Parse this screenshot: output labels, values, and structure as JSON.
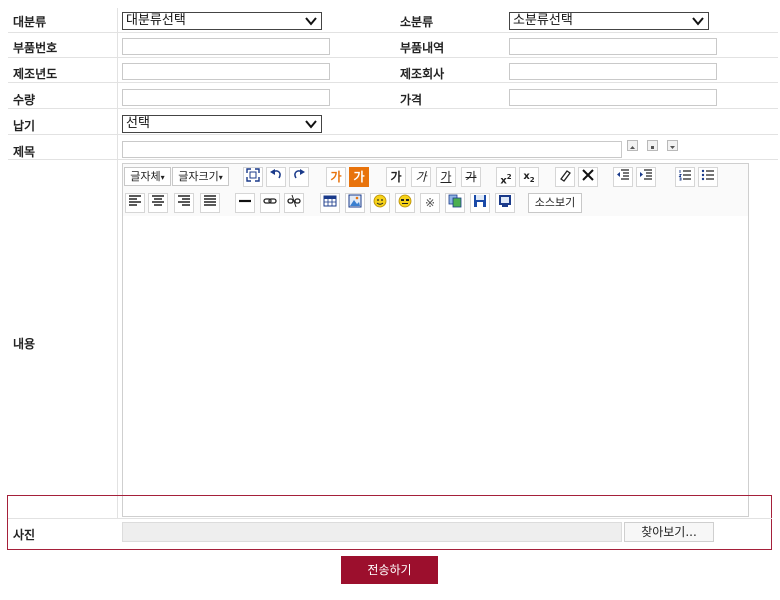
{
  "form": {
    "row_category": {
      "label": "대분류",
      "select_value": "대분류선택"
    },
    "row_subcategory": {
      "label": "소분류",
      "select_value": "소분류선택"
    },
    "row_part_number": {
      "label": "부품번호",
      "value": ""
    },
    "row_part_detail": {
      "label": "부품내역",
      "value": ""
    },
    "row_year": {
      "label": "제조년도",
      "value": ""
    },
    "row_maker": {
      "label": "제조회사",
      "value": ""
    },
    "row_quantity": {
      "label": "수량",
      "value": ""
    },
    "row_price": {
      "label": "가격",
      "value": ""
    },
    "row_delivery": {
      "label": "납기",
      "select_value": "선택"
    },
    "row_title": {
      "label": "제목",
      "value": ""
    },
    "row_content": {
      "label": "내용"
    },
    "row_photo": {
      "label": "사진",
      "browse_label": "찾아보기..."
    }
  },
  "editor": {
    "font_family_label": "글자체",
    "font_size_label": "글자크기",
    "text_color_glyph": "가",
    "bg_color_glyph": "가",
    "bold_glyph": "가",
    "italic_glyph": "가",
    "underline_glyph": "가",
    "strike_glyph": "가",
    "source_label": "소스보기",
    "icons": {
      "toolbar_row1": [
        "fullscreen-icon",
        "undo-icon",
        "redo-icon",
        "text-color-icon",
        "bg-color-icon",
        "bold-icon",
        "italic-icon",
        "underline-icon",
        "strike-icon",
        "superscript-icon",
        "subscript-icon",
        "eraser-icon",
        "delete-icon",
        "outdent-icon",
        "indent-icon",
        "ordered-list-icon",
        "unordered-list-icon"
      ],
      "toolbar_row2": [
        "align-left-icon",
        "align-center-icon",
        "align-right-icon",
        "align-justify-icon",
        "horizontal-rule-icon",
        "link-icon",
        "unlink-icon",
        "table-icon",
        "image-icon",
        "emoticon-icon",
        "emoji-icon",
        "special-char-icon",
        "copy-icon",
        "save-icon",
        "preview-icon"
      ]
    }
  },
  "submit_label": "전송하기",
  "colors": {
    "accent": "#9c0f2d",
    "highlight_border": "#a5203a",
    "orange": "#e8730c"
  }
}
